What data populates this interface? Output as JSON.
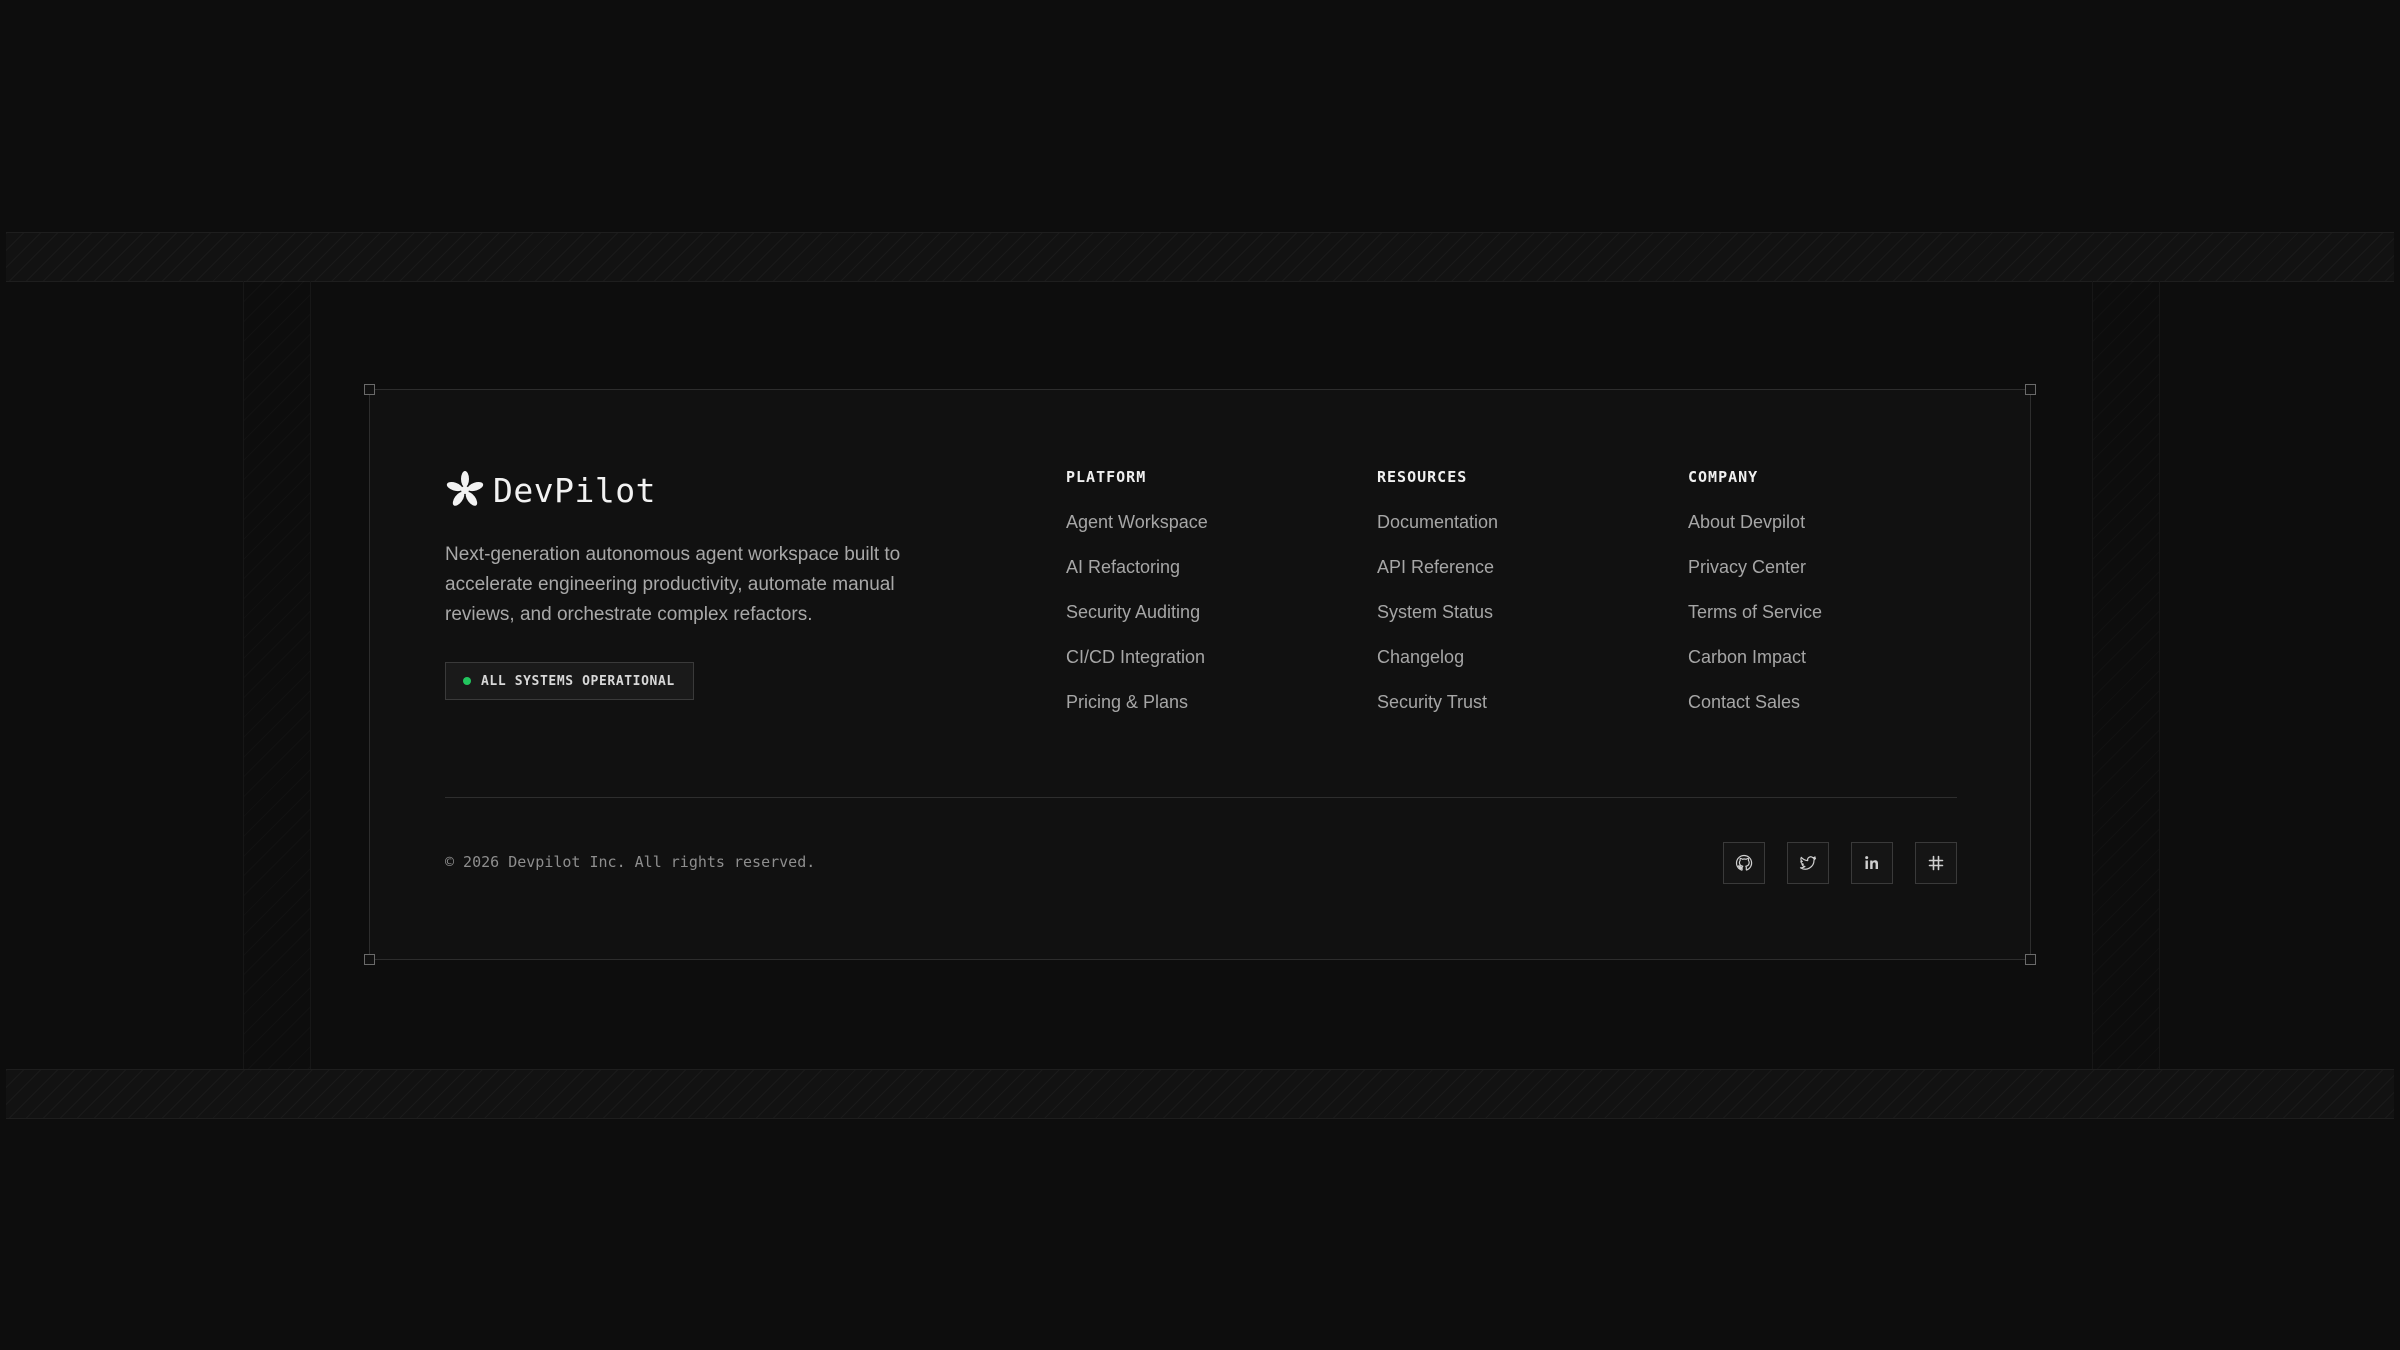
{
  "brand": {
    "name": "DevPilot",
    "tagline": "Next-generation autonomous agent workspace built to accelerate engineering productivity, automate manual reviews, and orchestrate complex refactors.",
    "logo_icon": "starburst-logo-icon"
  },
  "status": {
    "label": "ALL SYSTEMS OPERATIONAL",
    "indicator_color": "#22c55e"
  },
  "columns": {
    "platform": {
      "heading": "PLATFORM",
      "links": [
        "Agent Workspace",
        "AI Refactoring",
        "Security Auditing",
        "CI/CD Integration",
        "Pricing & Plans"
      ]
    },
    "resources": {
      "heading": "RESOURCES",
      "links": [
        "Documentation",
        "API Reference",
        "System Status",
        "Changelog",
        "Security Trust"
      ]
    },
    "company": {
      "heading": "COMPANY",
      "links": [
        "About Devpilot",
        "Privacy Center",
        "Terms of Service",
        "Carbon Impact",
        "Contact Sales"
      ]
    }
  },
  "footer": {
    "copyright": "© 2026 Devpilot Inc. All rights reserved."
  },
  "socials": [
    {
      "icon": "github-icon"
    },
    {
      "icon": "twitter-icon"
    },
    {
      "icon": "linkedin-icon"
    },
    {
      "icon": "slack-icon"
    }
  ],
  "colors": {
    "background": "#0d0d0d",
    "card": "#111111",
    "accent_status": "#22c55e"
  }
}
